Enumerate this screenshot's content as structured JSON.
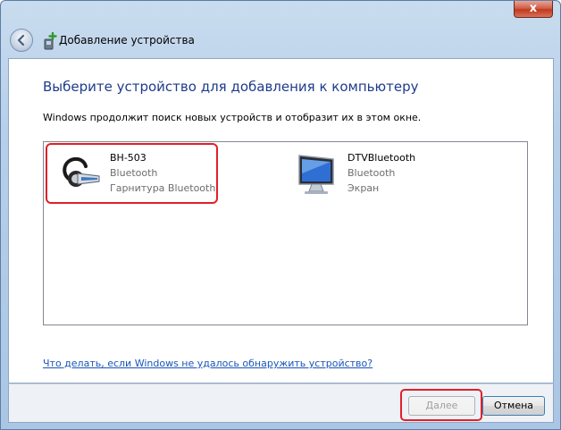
{
  "window": {
    "title": "Добавление устройства",
    "close_label": "x"
  },
  "main": {
    "heading": "Выберите устройство для добавления к компьютеру",
    "subtext": "Windows продолжит поиск новых устройств и отобразит их в этом окне.",
    "devices": [
      {
        "name": "BH-503",
        "type": "Bluetooth",
        "category": "Гарнитура Bluetooth",
        "icon": "headset-icon",
        "selected": true
      },
      {
        "name": "DTVBluetooth",
        "type": "Bluetooth",
        "category": "Экран",
        "icon": "monitor-icon",
        "selected": false
      }
    ],
    "help_link": "Что делать, если Windows не удалось обнаружить устройство?"
  },
  "footer": {
    "next_label": "Далее",
    "cancel_label": "Отмена"
  },
  "colors": {
    "heading": "#1e3c8c",
    "link": "#1a55b8",
    "highlight": "#e0202a"
  }
}
